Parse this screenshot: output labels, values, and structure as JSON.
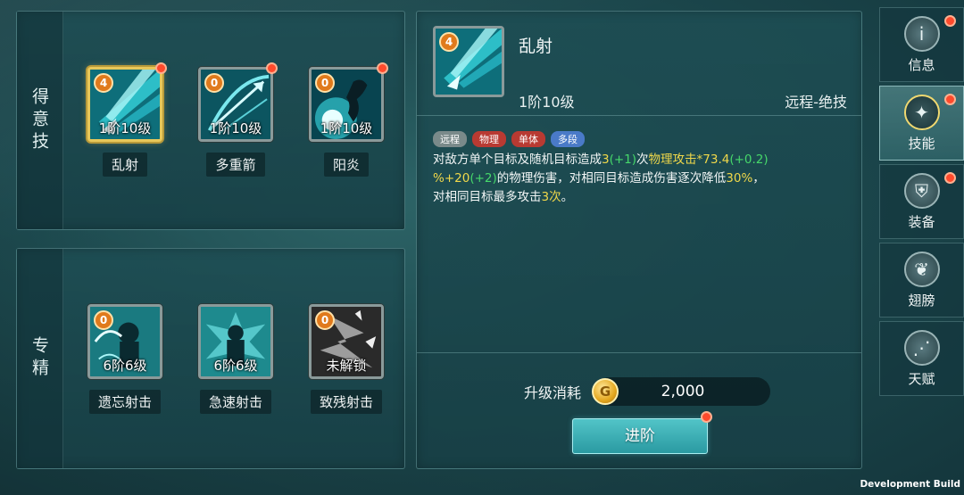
{
  "skills": {
    "section_label": "得意技",
    "items": [
      {
        "name": "乱射",
        "badge": "4",
        "level": "1阶10级",
        "selected": true,
        "alert": true
      },
      {
        "name": "多重箭",
        "badge": "0",
        "level": "1阶10级",
        "selected": false,
        "alert": true
      },
      {
        "name": "阳炎",
        "badge": "0",
        "level": "1阶10级",
        "selected": false,
        "alert": true
      }
    ]
  },
  "specialization": {
    "section_label": "专精",
    "items": [
      {
        "name": "遗忘射击",
        "badge": "0",
        "level": "6阶6级"
      },
      {
        "name": "急速射击",
        "badge": "",
        "level": "6阶6级"
      },
      {
        "name": "致残射击",
        "badge": "0",
        "level": "未解锁"
      }
    ]
  },
  "detail": {
    "badge": "4",
    "title": "乱射",
    "level": "1阶10级",
    "type": "远程-绝技",
    "tags": [
      {
        "label": "远程",
        "color": "#7a8a8a"
      },
      {
        "label": "物理",
        "color": "#b83a32"
      },
      {
        "label": "单体",
        "color": "#b83a32"
      },
      {
        "label": "多段",
        "color": "#4a7ac8"
      }
    ],
    "description": {
      "p1": "对敌方单个目标及随机目标造成",
      "n1": "3",
      "b1": "(+1)",
      "p2": "次",
      "n2": "物理攻击*73.4",
      "b2": "(+0.2)",
      "n3": "%+20",
      "b3": "(+2)",
      "p3": "的物理伤害，对相同目标造成伤害逐次降低",
      "n4": "30%",
      "p4": "，",
      "p5": "对相同目标最多攻击",
      "n5": "3次",
      "p6": "。"
    },
    "cost_label": "升级消耗",
    "coin_symbol": "G",
    "cost_value": "2,000",
    "advance_label": "进阶"
  },
  "nav": {
    "items": [
      {
        "label": "信息",
        "icon": "info-icon",
        "glyph": "i",
        "active": false,
        "alert": true
      },
      {
        "label": "技能",
        "icon": "skill-icon",
        "glyph": "✦",
        "active": true,
        "alert": true
      },
      {
        "label": "装备",
        "icon": "armor-icon",
        "glyph": "⛨",
        "active": false,
        "alert": true
      },
      {
        "label": "翅膀",
        "icon": "wing-icon",
        "glyph": "❦",
        "active": false,
        "alert": false
      },
      {
        "label": "天赋",
        "icon": "share-icon",
        "glyph": "⋰",
        "active": false,
        "alert": false
      }
    ]
  },
  "footer": {
    "dev_build": "Development Build"
  },
  "colors": {
    "accent": "#52c4c8",
    "highlight": "#f0d84a",
    "bonus": "#46d86a",
    "alert": "#ff4a2c"
  }
}
